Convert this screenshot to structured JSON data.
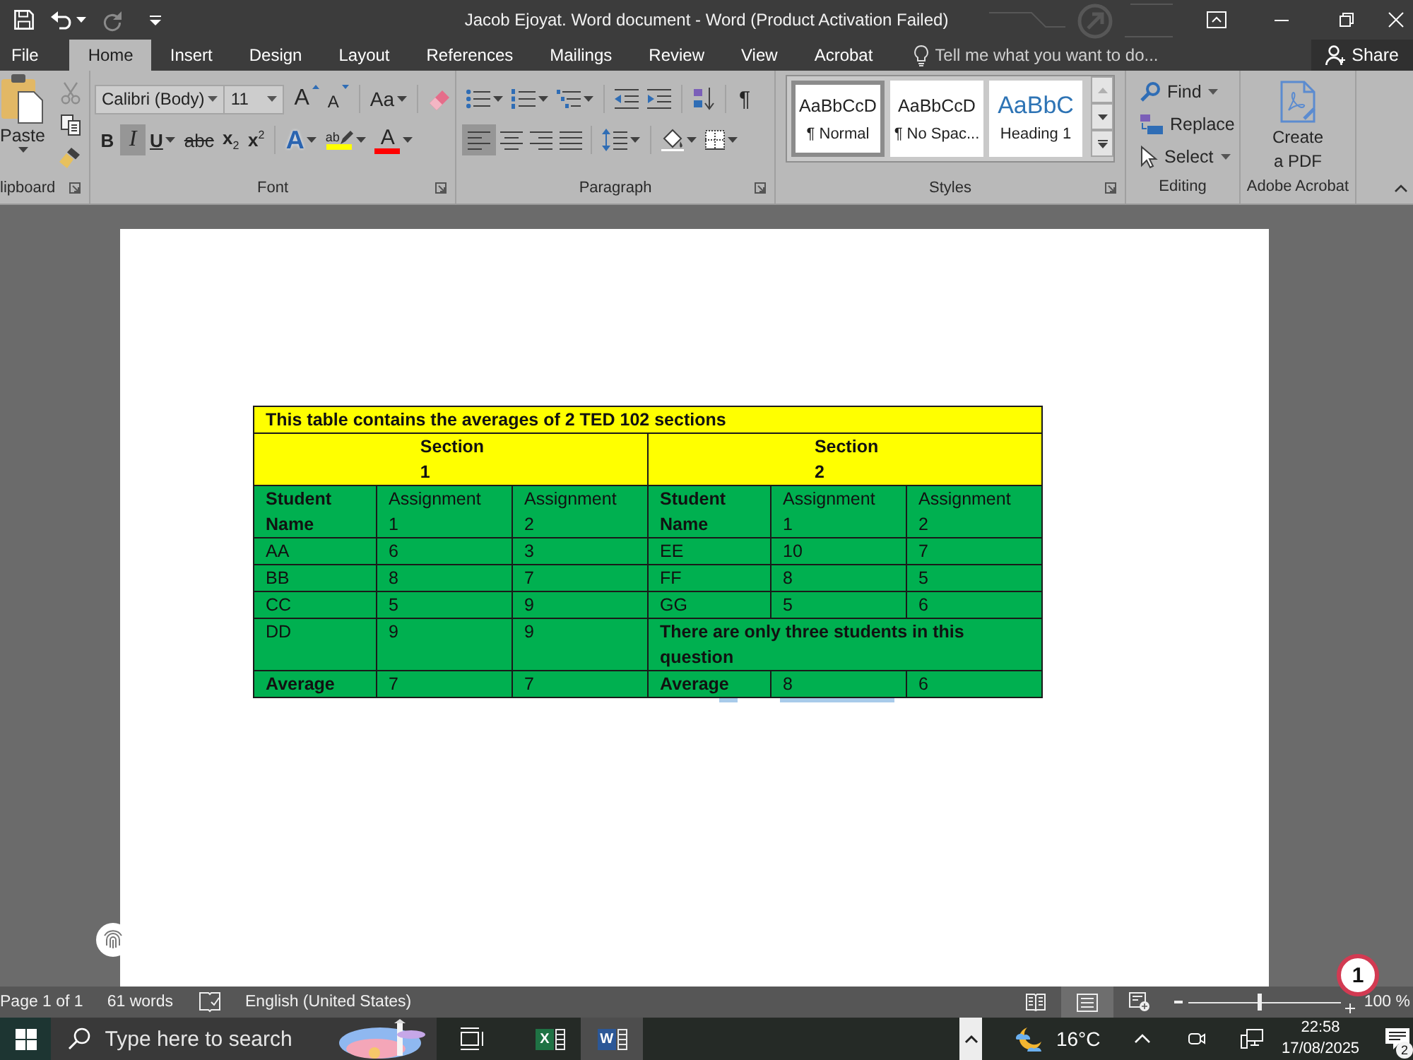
{
  "title_bar": {
    "title": "Jacob Ejoyat. Word document - Word (Product Activation Failed)",
    "quick_access": [
      {
        "kind": "save",
        "disabled": false
      },
      {
        "kind": "undo",
        "disabled": false
      },
      {
        "kind": "redo",
        "disabled": true
      },
      {
        "kind": "customize",
        "disabled": false
      }
    ]
  },
  "tabs": [
    {
      "label": "File",
      "selected": false
    },
    {
      "label": "Home",
      "selected": true
    },
    {
      "label": "Insert",
      "selected": false
    },
    {
      "label": "Design",
      "selected": false
    },
    {
      "label": "Layout",
      "selected": false
    },
    {
      "label": "References",
      "selected": false
    },
    {
      "label": "Mailings",
      "selected": false
    },
    {
      "label": "Review",
      "selected": false
    },
    {
      "label": "View",
      "selected": false
    },
    {
      "label": "Acrobat",
      "selected": false
    }
  ],
  "tell_me": {
    "placeholder": "Tell me what you want to do..."
  },
  "share": {
    "label": "Share"
  },
  "ribbon": {
    "clipboard": {
      "label": "lipboard",
      "paste": "Paste",
      "tools": [
        {
          "kind": "cut",
          "disabled": true
        },
        {
          "kind": "copy",
          "disabled": false
        },
        {
          "kind": "format_painter",
          "disabled": false
        }
      ]
    },
    "font": {
      "label": "Font",
      "font_name": "Calibri (Body)",
      "font_size": "11",
      "size_buttons": [
        {
          "kind": "grow",
          "label": "A"
        },
        {
          "kind": "shrink",
          "label": "A"
        }
      ],
      "case_button": "Aa",
      "toggles": [
        {
          "kind": "bold",
          "label": "B",
          "on": false
        },
        {
          "kind": "italic",
          "label": "I",
          "on": true
        },
        {
          "kind": "underline",
          "label": "U",
          "on": false
        },
        {
          "kind": "strike",
          "label": "abc",
          "on": false
        },
        {
          "kind": "subscript",
          "label": "x$_{2}$",
          "on": false
        },
        {
          "kind": "superscript",
          "label": "x$^{2}$",
          "on": false
        }
      ],
      "color_buttons": [
        {
          "kind": "effects",
          "label": "A"
        },
        {
          "kind": "highlight",
          "label": "ab",
          "color": "#ffff00"
        },
        {
          "kind": "font_color",
          "label": "A",
          "color": "#ff0000"
        }
      ]
    },
    "paragraph": {
      "label": "Paragraph",
      "show_marks": "¶",
      "alignments": [
        {
          "kind": "left",
          "selected": true
        },
        {
          "kind": "center",
          "selected": false
        },
        {
          "kind": "right",
          "selected": false
        },
        {
          "kind": "justify",
          "selected": false
        }
      ]
    },
    "styles": {
      "label": "Styles",
      "gallery": [
        {
          "kind": "body",
          "preview": "AaBbCcD",
          "name": "¶ Normal",
          "selected": true
        },
        {
          "kind": "body",
          "preview": "AaBbCcD",
          "name": "¶ No Spac...",
          "selected": false
        },
        {
          "kind": "heading",
          "preview": "AaBbC",
          "name": "Heading 1",
          "selected": false
        }
      ],
      "scroll": [
        {
          "kind": "up",
          "disabled": true
        },
        {
          "kind": "down",
          "disabled": false
        },
        {
          "kind": "more",
          "disabled": false
        }
      ]
    },
    "editing": {
      "label": "Editing",
      "commands": [
        {
          "kind": "find",
          "label": "Find"
        },
        {
          "kind": "replace",
          "label": "Replace"
        },
        {
          "kind": "select",
          "label": "Select"
        }
      ]
    },
    "acrobat": {
      "label": "Adobe Acrobat",
      "create_pdf": [
        "Create",
        "a PDF"
      ]
    }
  },
  "document": {
    "table": {
      "rows": [
        {
          "color": "#ffff00",
          "cells": [
            {
              "kind": "caption",
              "text": "This table contains the averages of 2 TED 102 sections",
              "colspan": 6
            }
          ]
        },
        {
          "color": "#ffff00",
          "cells": [
            {
              "kind": "section",
              "text": "Section 1",
              "colspan": 3
            },
            {
              "kind": "section",
              "text": "Section 2",
              "colspan": 3
            }
          ]
        },
        {
          "color": "#00b050",
          "cells": [
            {
              "kind": "name_header",
              "text": "Student Name"
            },
            {
              "kind": "column_header",
              "text": "Assignment 1"
            },
            {
              "kind": "column_header",
              "text": "Assignment 2"
            },
            {
              "kind": "name_header",
              "text": "Student Name"
            },
            {
              "kind": "column_header",
              "text": "Assignment 1"
            },
            {
              "kind": "column_header",
              "text": "Assignment 2"
            }
          ]
        },
        {
          "color": "#00b050",
          "cells": [
            {
              "kind": "text",
              "text": "AA"
            },
            {
              "kind": "text",
              "text": "6"
            },
            {
              "kind": "text",
              "text": "3"
            },
            {
              "kind": "text",
              "text": "EE"
            },
            {
              "kind": "text",
              "text": "10"
            },
            {
              "kind": "text",
              "text": "7"
            }
          ]
        },
        {
          "color": "#00b050",
          "cells": [
            {
              "kind": "text",
              "text": "BB"
            },
            {
              "kind": "text",
              "text": "8"
            },
            {
              "kind": "text",
              "text": "7"
            },
            {
              "kind": "text",
              "text": "FF"
            },
            {
              "kind": "text",
              "text": "8"
            },
            {
              "kind": "text",
              "text": "5"
            }
          ]
        },
        {
          "color": "#00b050",
          "cells": [
            {
              "kind": "text",
              "text": "CC"
            },
            {
              "kind": "text",
              "text": "5"
            },
            {
              "kind": "text",
              "text": "9"
            },
            {
              "kind": "text",
              "text": "GG"
            },
            {
              "kind": "text",
              "text": "5"
            },
            {
              "kind": "text",
              "text": "6"
            }
          ]
        },
        {
          "color": "#00b050",
          "cells": [
            {
              "kind": "text",
              "text": "DD"
            },
            {
              "kind": "text",
              "text": "9"
            },
            {
              "kind": "text",
              "text": "9"
            },
            {
              "kind": "note",
              "text": "There are only three students in this question",
              "colspan": 3
            }
          ]
        },
        {
          "color": "#00b050",
          "cells": [
            {
              "kind": "total",
              "text": "Average"
            },
            {
              "kind": "text",
              "text": "7"
            },
            {
              "kind": "text",
              "text": "7"
            },
            {
              "kind": "total",
              "text": "Average"
            },
            {
              "kind": "text",
              "text": "8"
            },
            {
              "kind": "text",
              "text": "6"
            }
          ]
        }
      ]
    }
  },
  "status_bar": {
    "page": "Page 1 of 1",
    "words": "61 words",
    "language": "English (United States)",
    "views": [
      {
        "kind": "read",
        "selected": false
      },
      {
        "kind": "print",
        "selected": true
      },
      {
        "kind": "web",
        "selected": false
      }
    ],
    "zoom": {
      "level": 0.46,
      "reading": "100 %"
    }
  },
  "taskbar": {
    "search": {
      "placeholder": "Type here to search"
    },
    "apps": [
      {
        "kind": "excel",
        "label": "X",
        "selected": false
      },
      {
        "kind": "word",
        "label": "W",
        "selected": true
      }
    ],
    "weather": "16°C",
    "time": "22:58",
    "date": "17/08/2025",
    "notifications": "2"
  },
  "annotation": {
    "label": "1"
  }
}
